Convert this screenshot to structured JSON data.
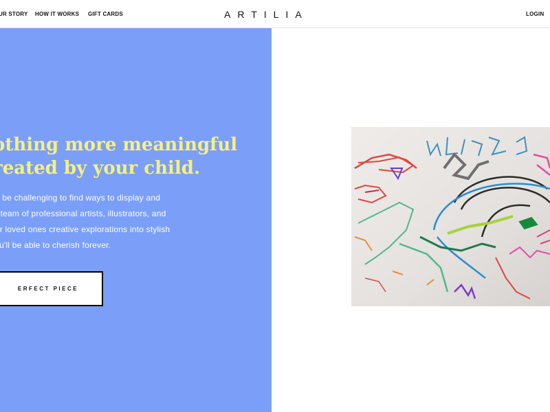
{
  "header": {
    "nav": {
      "our_story": "UR STORY",
      "how_it_works": "HOW IT WORKS",
      "gift_cards": "GIFT CARDS"
    },
    "logo": "ARTILIA",
    "login": "LOGIN"
  },
  "hero": {
    "background_color": "#7b9ff8",
    "headline_color": "#f7f17c",
    "headline_lines": [
      "othing more meaningful",
      "reated by your child."
    ],
    "body_lines": [
      "an be challenging to find ways to display and",
      "ur team of professional artists, illustrators, and",
      "our loved ones creative explorations into stylish",
      "you'll be able to cherish forever."
    ],
    "cta_label": "ERFECT PIECE"
  },
  "artwork": {
    "icon": "child-drawing-image"
  }
}
